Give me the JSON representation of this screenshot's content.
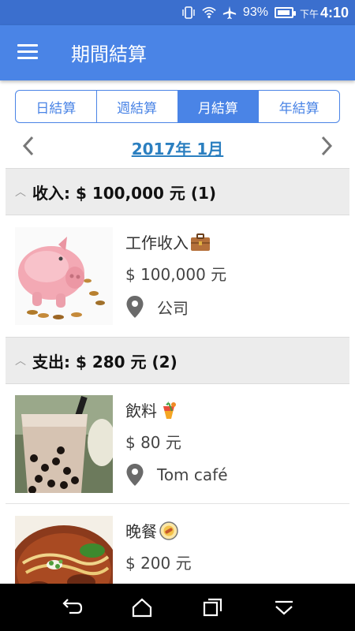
{
  "status_bar": {
    "battery_percent": "93%",
    "battery_level": 0.93,
    "time_prefix": "下午",
    "time": "4:10",
    "icons": [
      "vibrate-icon",
      "wifi-icon",
      "airplane-icon",
      "battery-icon"
    ]
  },
  "app_bar": {
    "title": "期間結算",
    "menu_icon": "hamburger-menu-icon"
  },
  "segments": {
    "items": [
      "日結算",
      "週結算",
      "月結算",
      "年結算"
    ],
    "selected": "月結算"
  },
  "month_nav": {
    "label": "2017年 1月",
    "prev_icon": "chevron-left-icon",
    "next_icon": "chevron-right-icon"
  },
  "sections": [
    {
      "title": "收入: $ 100,000 元 (1)",
      "entries": [
        {
          "name": "工作收入",
          "icon": "briefcase-icon",
          "amount": "$ 100,000 元",
          "location": "公司",
          "image": "piggy-bank"
        }
      ]
    },
    {
      "title": "支出: $ 280 元 (2)",
      "entries": [
        {
          "name": "飲料",
          "icon": "tropical-drink-icon",
          "amount": "$ 80 元",
          "location": "Tom café",
          "image": "bubble-tea"
        },
        {
          "name": "晚餐",
          "icon": "dinner-plate-icon",
          "amount": "$ 200 元",
          "image": "beef-noodle-soup"
        }
      ]
    }
  ],
  "nav_bar": {
    "buttons": [
      "back-icon",
      "home-icon",
      "recents-icon",
      "hide-keyboard-icon"
    ]
  }
}
